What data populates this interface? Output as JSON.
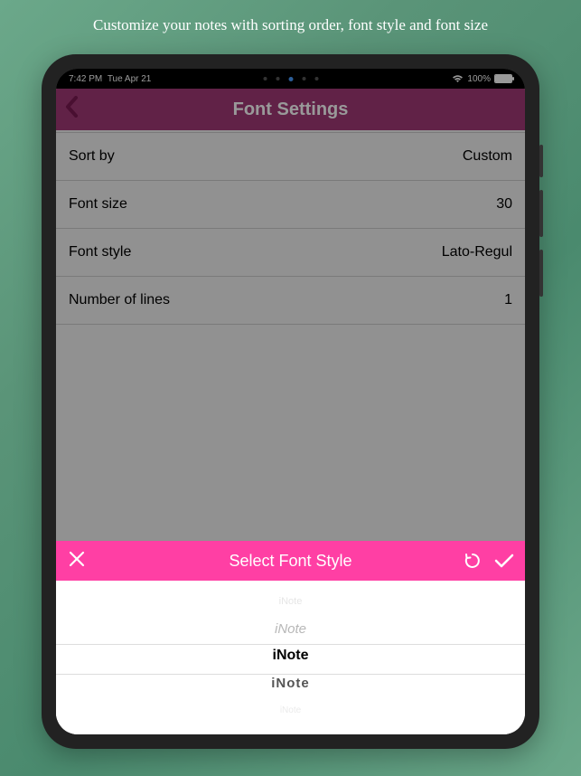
{
  "caption": "Customize your notes with sorting order, font style and font size",
  "status": {
    "time": "7:42 PM",
    "date": "Tue Apr 21",
    "battery": "100%"
  },
  "header": {
    "title": "Font Settings"
  },
  "settings": [
    {
      "label": "Sort by",
      "value": "Custom"
    },
    {
      "label": "Font size",
      "value": "30"
    },
    {
      "label": "Font style",
      "value": "Lato-Regul"
    },
    {
      "label": "Number of lines",
      "value": "1"
    }
  ],
  "picker": {
    "title": "Select Font Style",
    "items": [
      "iNote",
      "iNote",
      "iNote",
      "iNote",
      "iNote"
    ]
  }
}
